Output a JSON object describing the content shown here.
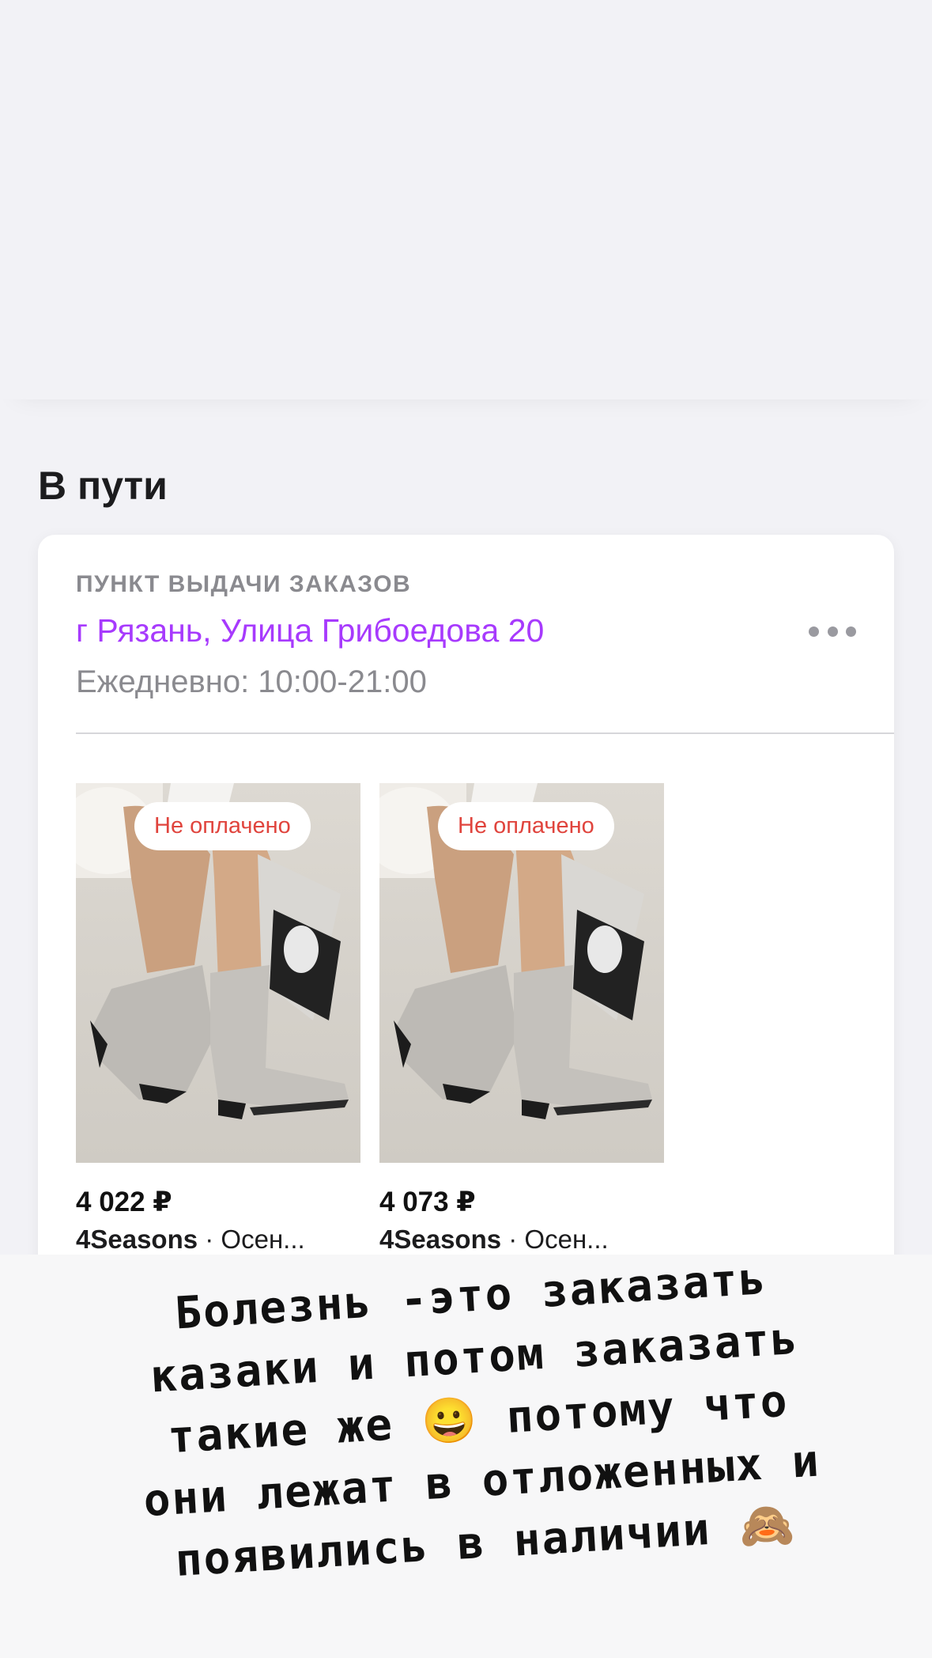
{
  "section": {
    "title": "В пути"
  },
  "pickup": {
    "label": "ПУНКТ ВЫДАЧИ ЗАКАЗОВ",
    "address": "г Рязань, Улица Грибоедова 20",
    "hours": "Ежедневно: 10:00-21:00",
    "more_icon": "more-horizontal-icon"
  },
  "products": [
    {
      "badge": "Не оплачено",
      "price": "4 022 ₽",
      "brand": "4Seasons",
      "description": " · Осен..."
    },
    {
      "badge": "Не оплачено",
      "price": "4 073 ₽",
      "brand": "4Seasons",
      "description": " · Осен..."
    }
  ],
  "caption": {
    "lines": [
      "Болезнь -это заказать",
      "казаки и потом заказать",
      "такие же 😀 потому что",
      "они лежат в отложенных и",
      "появились в наличии 🙈"
    ]
  },
  "colors": {
    "accent": "#a73afd",
    "badge_text": "#e0443d",
    "background": "#f2f2f6"
  }
}
